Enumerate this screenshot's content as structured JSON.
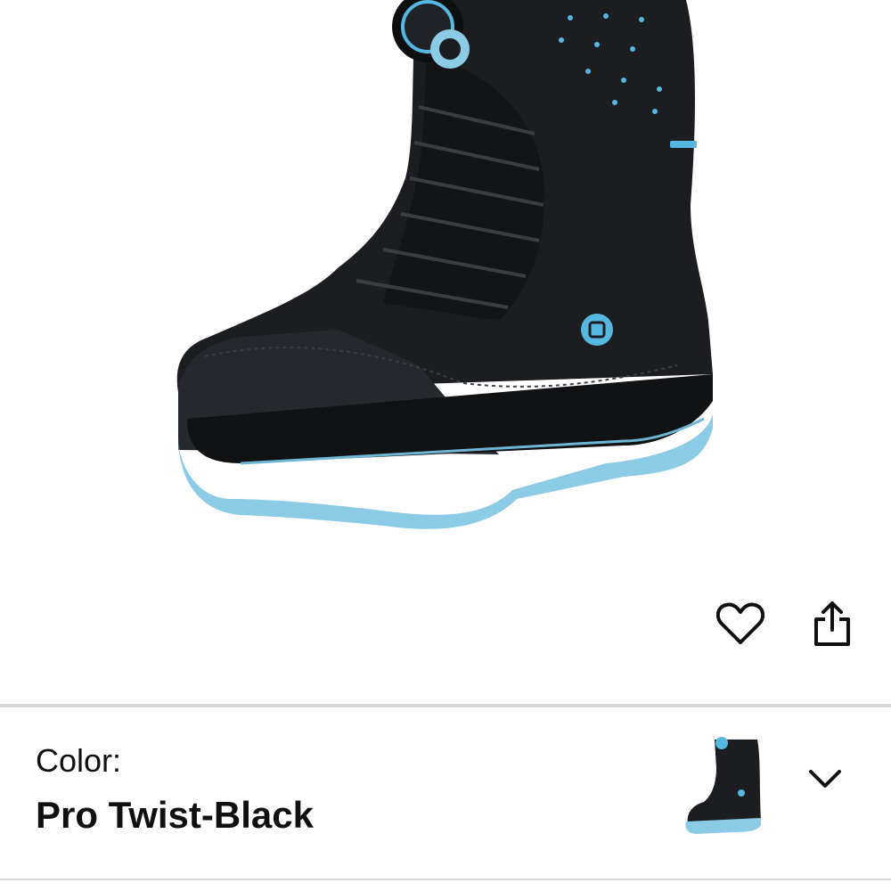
{
  "product": {
    "image_alt": "Snowboard boot, black with light blue sole and BOA dial",
    "colors": {
      "upper": "#1b1d20",
      "sole": "#8ccbe6",
      "accent": "#56b7e0"
    }
  },
  "actions": {
    "wishlist_icon": "heart-icon",
    "share_icon": "share-icon"
  },
  "variation": {
    "label": "Color:",
    "value": "Pro Twist-Black",
    "expand_icon": "chevron-down-icon"
  }
}
